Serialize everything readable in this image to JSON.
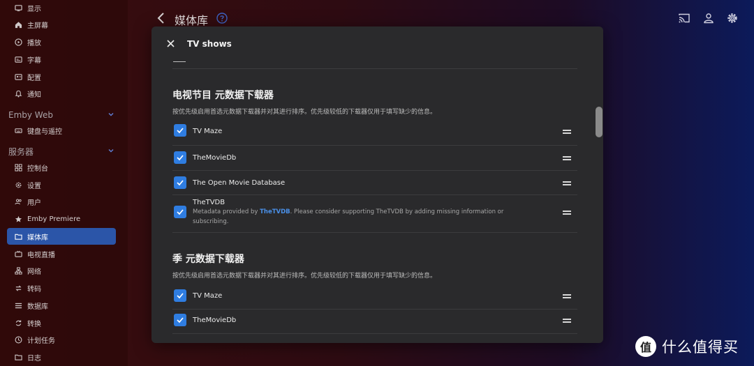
{
  "sidebar": {
    "items_top": [
      {
        "label": "显示",
        "icon": "display-icon"
      },
      {
        "label": "主屏幕",
        "icon": "home-icon"
      },
      {
        "label": "播放",
        "icon": "play-icon"
      },
      {
        "label": "字幕",
        "icon": "subtitles-icon"
      },
      {
        "label": "配置",
        "icon": "profile-icon"
      },
      {
        "label": "通知",
        "icon": "bell-icon"
      }
    ],
    "section_web": {
      "title": "Emby Web"
    },
    "items_web": [
      {
        "label": "键盘与遥控",
        "icon": "keyboard-icon"
      }
    ],
    "section_server": {
      "title": "服务器"
    },
    "items_server": [
      {
        "label": "控制台",
        "icon": "dashboard-icon"
      },
      {
        "label": "设置",
        "icon": "gear-icon"
      },
      {
        "label": "用户",
        "icon": "users-icon"
      },
      {
        "label": "Emby Premiere",
        "icon": "star-icon"
      },
      {
        "label": "媒体库",
        "icon": "folder-icon",
        "active": true
      },
      {
        "label": "电视直播",
        "icon": "tv-icon"
      },
      {
        "label": "网络",
        "icon": "network-icon"
      },
      {
        "label": "转码",
        "icon": "transcode-icon"
      },
      {
        "label": "数据库",
        "icon": "database-icon"
      },
      {
        "label": "转换",
        "icon": "convert-icon"
      },
      {
        "label": "计划任务",
        "icon": "clock-icon"
      },
      {
        "label": "日志",
        "icon": "log-folder-icon"
      }
    ]
  },
  "header": {
    "title": "媒体库"
  },
  "modal": {
    "title": "TV shows",
    "section1": {
      "title": "电视节目 元数据下载器",
      "desc": "按优先级启用首选元数据下载器并对其进行排序。优先级较低的下载器仅用于填写缺少的信息。",
      "rows": [
        {
          "label": "TV Maze",
          "checked": true
        },
        {
          "label": "TheMovieDb",
          "checked": true
        },
        {
          "label": "The Open Movie Database",
          "checked": true
        },
        {
          "label": "TheTVDB",
          "checked": true,
          "sub_prefix": "Metadata provided by ",
          "sub_link": "TheTVDB",
          "sub_suffix": ". Please consider supporting TheTVDB by adding missing information or subscribing."
        }
      ]
    },
    "section2": {
      "title": "季 元数据下载器",
      "desc": "按优先级启用首选元数据下载器并对其进行排序。优先级较低的下载器仅用于填写缺少的信息。",
      "rows": [
        {
          "label": "TV Maze",
          "checked": true
        },
        {
          "label": "TheMovieDb",
          "checked": true
        }
      ]
    }
  },
  "watermark": {
    "text": "什么值得买",
    "logo_text": "值"
  },
  "colors": {
    "accent": "#2f7de1",
    "active_nav": "#2b55a8",
    "modal_bg": "#2a2a2c",
    "link": "#4a90e8"
  }
}
